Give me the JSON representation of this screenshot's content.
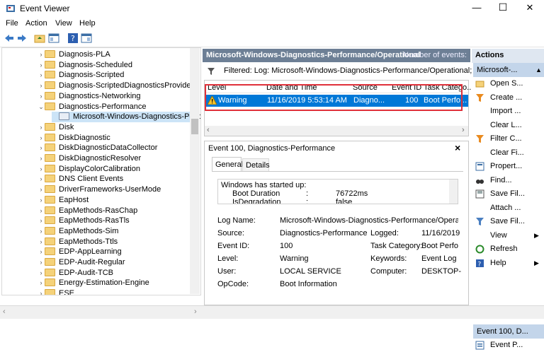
{
  "window": {
    "title": "Event Viewer",
    "minimize": "—",
    "maximize": "☐",
    "close": "✕"
  },
  "menu": [
    "File",
    "Action",
    "View",
    "Help"
  ],
  "tree": {
    "items": [
      {
        "label": "Diagnosis-PLA",
        "expanded": false
      },
      {
        "label": "Diagnosis-Scheduled",
        "expanded": false
      },
      {
        "label": "Diagnosis-Scripted",
        "expanded": false
      },
      {
        "label": "Diagnosis-ScriptedDiagnosticsProvider",
        "expanded": false
      },
      {
        "label": "Diagnostics-Networking",
        "expanded": false
      },
      {
        "label": "Diagnostics-Performance",
        "expanded": true
      },
      {
        "label": "Microsoft-Windows-Diagnostics-Perfo",
        "selected": true
      },
      {
        "label": "Disk",
        "expanded": false
      },
      {
        "label": "DiskDiagnostic",
        "expanded": false
      },
      {
        "label": "DiskDiagnosticDataCollector",
        "expanded": false
      },
      {
        "label": "DiskDiagnosticResolver",
        "expanded": false
      },
      {
        "label": "DisplayColorCalibration",
        "expanded": false
      },
      {
        "label": "DNS Client Events",
        "expanded": false
      },
      {
        "label": "DriverFrameworks-UserMode",
        "expanded": false
      },
      {
        "label": "EapHost",
        "expanded": false
      },
      {
        "label": "EapMethods-RasChap",
        "expanded": false
      },
      {
        "label": "EapMethods-RasTls",
        "expanded": false
      },
      {
        "label": "EapMethods-Sim",
        "expanded": false
      },
      {
        "label": "EapMethods-Ttls",
        "expanded": false
      },
      {
        "label": "EDP-AppLearning",
        "expanded": false
      },
      {
        "label": "EDP-Audit-Regular",
        "expanded": false
      },
      {
        "label": "EDP-Audit-TCB",
        "expanded": false
      },
      {
        "label": "Energy-Estimation-Engine",
        "expanded": false
      },
      {
        "label": "ESE",
        "expanded": false
      }
    ]
  },
  "log": {
    "title": "Microsoft-Windows-Diagnostics-Performance/Operational",
    "count_label": "Number of events:",
    "filter": "Filtered: Log: Microsoft-Windows-Diagnostics-Performance/Operational;",
    "columns": [
      "Level",
      "Date and Time",
      "Source",
      "Event ID",
      "Task Catego..."
    ],
    "row": {
      "level": "Warning",
      "date": "11/16/2019 5:53:14 AM",
      "source": "Diagno...",
      "event_id": "100",
      "task": "Boot Perfo..."
    }
  },
  "detail": {
    "title": "Event 100, Diagnostics-Performance",
    "close": "×",
    "tabs": [
      "General",
      "Details"
    ],
    "message": {
      "line1": "Windows has started up:",
      "k1": "Boot Duration",
      "sep1": ":",
      "v1": "76722ms",
      "k2": "IsDegradation",
      "sep2": ":",
      "v2": "false"
    },
    "fields": {
      "log_name_label": "Log Name:",
      "log_name": "Microsoft-Windows-Diagnostics-Performance/Operatio",
      "source_label": "Source:",
      "source": "Diagnostics-Performance",
      "logged_label": "Logged:",
      "logged": "11/16/2019",
      "event_id_label": "Event ID:",
      "event_id": "100",
      "task_label": "Task Category:",
      "task": "Boot Perfo",
      "level_label": "Level:",
      "level": "Warning",
      "keywords_label": "Keywords:",
      "keywords": "Event Log",
      "user_label": "User:",
      "user": "LOCAL SERVICE",
      "computer_label": "Computer:",
      "computer": "DESKTOP-",
      "opcode_label": "OpCode:",
      "opcode": "Boot Information"
    }
  },
  "actions": {
    "header": "Actions",
    "section1": "Microsoft-...",
    "items1": [
      {
        "label": "Open S...",
        "icon": "folder-open-icon"
      },
      {
        "label": "Create ...",
        "icon": "filter-icon"
      },
      {
        "label": "Import ...",
        "icon": ""
      },
      {
        "label": "Clear L...",
        "icon": ""
      },
      {
        "label": "Filter C...",
        "icon": "filter-icon"
      },
      {
        "label": "Clear Fi...",
        "icon": ""
      },
      {
        "label": "Propert...",
        "icon": "properties-icon"
      },
      {
        "label": "Find...",
        "icon": "binoculars-icon"
      },
      {
        "label": "Save Fil...",
        "icon": "save-icon"
      },
      {
        "label": "Attach ...",
        "icon": ""
      },
      {
        "label": "Save Fil...",
        "icon": "save-filter-icon"
      },
      {
        "label": "View",
        "icon": ""
      },
      {
        "label": "Refresh",
        "icon": "refresh-icon"
      },
      {
        "label": "Help",
        "icon": "help-icon"
      }
    ],
    "section2": "Event 100, D...",
    "items2": [
      {
        "label": "Event P...",
        "icon": "event-properties-icon"
      }
    ]
  }
}
